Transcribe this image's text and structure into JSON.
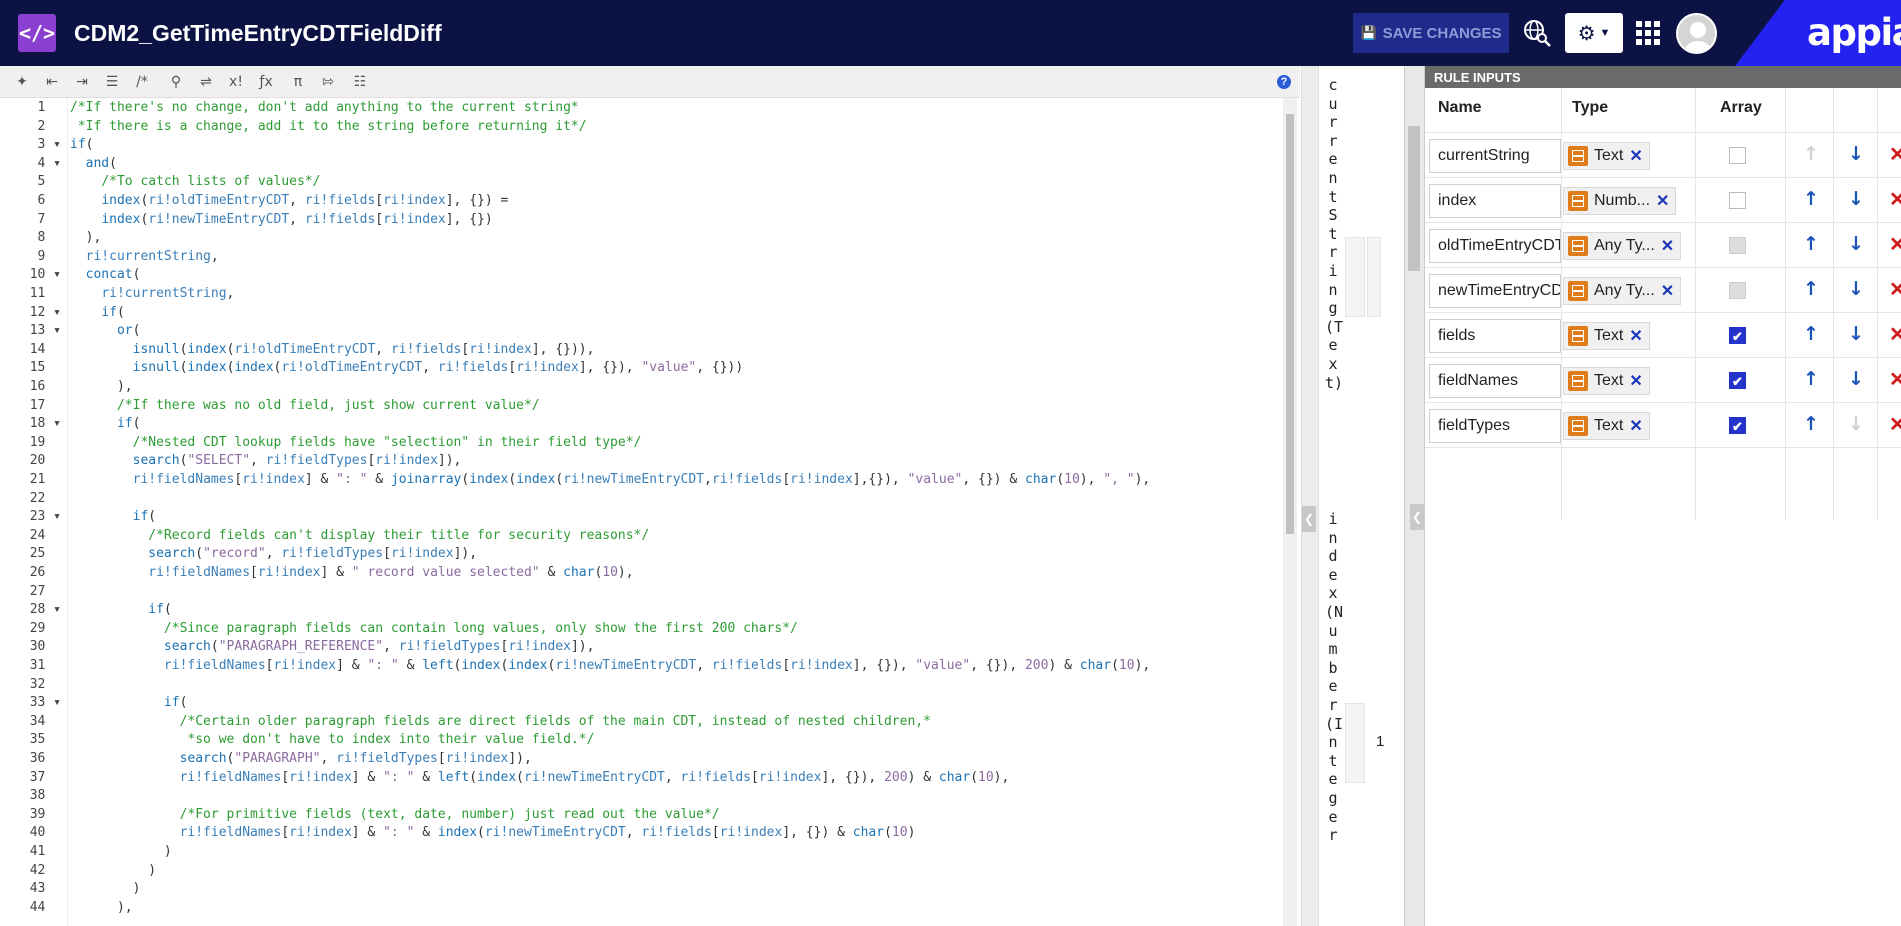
{
  "header": {
    "title": "CDM2_GetTimeEntryCDTFieldDiff",
    "save_label": "SAVE CHANGES",
    "logo": "appian"
  },
  "editor": {
    "lines": [
      [
        [
          "c",
          "/*If there's no change, don't add anything to the current string*"
        ]
      ],
      [
        [
          "c",
          " *If there is a change, add it to the string before returning it*/"
        ]
      ],
      [
        [
          "f",
          "if"
        ],
        [
          "p",
          "("
        ]
      ],
      [
        [
          "p",
          "  "
        ],
        [
          "f",
          "and"
        ],
        [
          "p",
          "("
        ]
      ],
      [
        [
          "p",
          "    "
        ],
        [
          "c",
          "/*To catch lists of values*/"
        ]
      ],
      [
        [
          "p",
          "    "
        ],
        [
          "f",
          "index"
        ],
        [
          "p",
          "("
        ],
        [
          "r",
          "ri!oldTimeEntryCDT"
        ],
        [
          "p",
          ", "
        ],
        [
          "r",
          "ri!fields"
        ],
        [
          "p",
          "["
        ],
        [
          "r",
          "ri!index"
        ],
        [
          "p",
          "], {}) ="
        ]
      ],
      [
        [
          "p",
          "    "
        ],
        [
          "f",
          "index"
        ],
        [
          "p",
          "("
        ],
        [
          "r",
          "ri!newTimeEntryCDT"
        ],
        [
          "p",
          ", "
        ],
        [
          "r",
          "ri!fields"
        ],
        [
          "p",
          "["
        ],
        [
          "r",
          "ri!index"
        ],
        [
          "p",
          "], {})"
        ]
      ],
      [
        [
          "p",
          "  ),"
        ]
      ],
      [
        [
          "p",
          "  "
        ],
        [
          "r",
          "ri!currentString"
        ],
        [
          "p",
          ","
        ]
      ],
      [
        [
          "p",
          "  "
        ],
        [
          "f",
          "concat"
        ],
        [
          "p",
          "("
        ]
      ],
      [
        [
          "p",
          "    "
        ],
        [
          "r",
          "ri!currentString"
        ],
        [
          "p",
          ","
        ]
      ],
      [
        [
          "p",
          "    "
        ],
        [
          "f",
          "if"
        ],
        [
          "p",
          "("
        ]
      ],
      [
        [
          "p",
          "      "
        ],
        [
          "f",
          "or"
        ],
        [
          "p",
          "("
        ]
      ],
      [
        [
          "p",
          "        "
        ],
        [
          "f",
          "isnull"
        ],
        [
          "p",
          "("
        ],
        [
          "f",
          "index"
        ],
        [
          "p",
          "("
        ],
        [
          "r",
          "ri!oldTimeEntryCDT"
        ],
        [
          "p",
          ", "
        ],
        [
          "r",
          "ri!fields"
        ],
        [
          "p",
          "["
        ],
        [
          "r",
          "ri!index"
        ],
        [
          "p",
          "], {})),"
        ]
      ],
      [
        [
          "p",
          "        "
        ],
        [
          "f",
          "isnull"
        ],
        [
          "p",
          "("
        ],
        [
          "f",
          "index"
        ],
        [
          "p",
          "("
        ],
        [
          "f",
          "index"
        ],
        [
          "p",
          "("
        ],
        [
          "r",
          "ri!oldTimeEntryCDT"
        ],
        [
          "p",
          ", "
        ],
        [
          "r",
          "ri!fields"
        ],
        [
          "p",
          "["
        ],
        [
          "r",
          "ri!index"
        ],
        [
          "p",
          "], {}), "
        ],
        [
          "s",
          "\"value\""
        ],
        [
          "p",
          ", {}))"
        ]
      ],
      [
        [
          "p",
          "      ),"
        ]
      ],
      [
        [
          "p",
          "      "
        ],
        [
          "c",
          "/*If there was no old field, just show current value*/"
        ]
      ],
      [
        [
          "p",
          "      "
        ],
        [
          "f",
          "if"
        ],
        [
          "p",
          "("
        ]
      ],
      [
        [
          "p",
          "        "
        ],
        [
          "c",
          "/*Nested CDT lookup fields have \"selection\" in their field type*/"
        ]
      ],
      [
        [
          "p",
          "        "
        ],
        [
          "f",
          "search"
        ],
        [
          "p",
          "("
        ],
        [
          "s",
          "\"SELECT\""
        ],
        [
          "p",
          ", "
        ],
        [
          "r",
          "ri!fieldTypes"
        ],
        [
          "p",
          "["
        ],
        [
          "r",
          "ri!index"
        ],
        [
          "p",
          "]),"
        ]
      ],
      [
        [
          "p",
          "        "
        ],
        [
          "r",
          "ri!fieldNames"
        ],
        [
          "p",
          "["
        ],
        [
          "r",
          "ri!index"
        ],
        [
          "p",
          "] & "
        ],
        [
          "s",
          "\": \""
        ],
        [
          "p",
          " & "
        ],
        [
          "f",
          "joinarray"
        ],
        [
          "p",
          "("
        ],
        [
          "f",
          "index"
        ],
        [
          "p",
          "("
        ],
        [
          "f",
          "index"
        ],
        [
          "p",
          "("
        ],
        [
          "r",
          "ri!newTimeEntryCDT"
        ],
        [
          "p",
          ","
        ],
        [
          "r",
          "ri!fields"
        ],
        [
          "p",
          "["
        ],
        [
          "r",
          "ri!index"
        ],
        [
          "p",
          "],{}), "
        ],
        [
          "s",
          "\"value\""
        ],
        [
          "p",
          ", {}) & "
        ],
        [
          "f",
          "char"
        ],
        [
          "p",
          "("
        ],
        [
          "n",
          "10"
        ],
        [
          "p",
          "), "
        ],
        [
          "s",
          "\", \""
        ],
        [
          "p",
          "),"
        ]
      ],
      [],
      [
        [
          "p",
          "        "
        ],
        [
          "f",
          "if"
        ],
        [
          "p",
          "("
        ]
      ],
      [
        [
          "p",
          "          "
        ],
        [
          "c",
          "/*Record fields can't display their title for security reasons*/"
        ]
      ],
      [
        [
          "p",
          "          "
        ],
        [
          "f",
          "search"
        ],
        [
          "p",
          "("
        ],
        [
          "s",
          "\"record\""
        ],
        [
          "p",
          ", "
        ],
        [
          "r",
          "ri!fieldTypes"
        ],
        [
          "p",
          "["
        ],
        [
          "r",
          "ri!index"
        ],
        [
          "p",
          "]),"
        ]
      ],
      [
        [
          "p",
          "          "
        ],
        [
          "r",
          "ri!fieldNames"
        ],
        [
          "p",
          "["
        ],
        [
          "r",
          "ri!index"
        ],
        [
          "p",
          "] & "
        ],
        [
          "s",
          "\" record value selected\""
        ],
        [
          "p",
          " & "
        ],
        [
          "f",
          "char"
        ],
        [
          "p",
          "("
        ],
        [
          "n",
          "10"
        ],
        [
          "p",
          "),"
        ]
      ],
      [],
      [
        [
          "p",
          "          "
        ],
        [
          "f",
          "if"
        ],
        [
          "p",
          "("
        ]
      ],
      [
        [
          "p",
          "            "
        ],
        [
          "c",
          "/*Since paragraph fields can contain long values, only show the first 200 chars*/"
        ]
      ],
      [
        [
          "p",
          "            "
        ],
        [
          "f",
          "search"
        ],
        [
          "p",
          "("
        ],
        [
          "s",
          "\"PARAGRAPH_REFERENCE\""
        ],
        [
          "p",
          ", "
        ],
        [
          "r",
          "ri!fieldTypes"
        ],
        [
          "p",
          "["
        ],
        [
          "r",
          "ri!index"
        ],
        [
          "p",
          "]),"
        ]
      ],
      [
        [
          "p",
          "            "
        ],
        [
          "r",
          "ri!fieldNames"
        ],
        [
          "p",
          "["
        ],
        [
          "r",
          "ri!index"
        ],
        [
          "p",
          "] & "
        ],
        [
          "s",
          "\": \""
        ],
        [
          "p",
          " & "
        ],
        [
          "f",
          "left"
        ],
        [
          "p",
          "("
        ],
        [
          "f",
          "index"
        ],
        [
          "p",
          "("
        ],
        [
          "f",
          "index"
        ],
        [
          "p",
          "("
        ],
        [
          "r",
          "ri!newTimeEntryCDT"
        ],
        [
          "p",
          ", "
        ],
        [
          "r",
          "ri!fields"
        ],
        [
          "p",
          "["
        ],
        [
          "r",
          "ri!index"
        ],
        [
          "p",
          "], {}), "
        ],
        [
          "s",
          "\"value\""
        ],
        [
          "p",
          ", {}), "
        ],
        [
          "n",
          "200"
        ],
        [
          "p",
          ") & "
        ],
        [
          "f",
          "char"
        ],
        [
          "p",
          "("
        ],
        [
          "n",
          "10"
        ],
        [
          "p",
          "),"
        ]
      ],
      [],
      [
        [
          "p",
          "            "
        ],
        [
          "f",
          "if"
        ],
        [
          "p",
          "("
        ]
      ],
      [
        [
          "p",
          "              "
        ],
        [
          "c",
          "/*Certain older paragraph fields are direct fields of the main CDT, instead of nested children,*"
        ]
      ],
      [
        [
          "p",
          "              "
        ],
        [
          "c",
          " *so we don't have to index into their value field.*/"
        ]
      ],
      [
        [
          "p",
          "              "
        ],
        [
          "f",
          "search"
        ],
        [
          "p",
          "("
        ],
        [
          "s",
          "\"PARAGRAPH\""
        ],
        [
          "p",
          ", "
        ],
        [
          "r",
          "ri!fieldTypes"
        ],
        [
          "p",
          "["
        ],
        [
          "r",
          "ri!index"
        ],
        [
          "p",
          "]),"
        ]
      ],
      [
        [
          "p",
          "              "
        ],
        [
          "r",
          "ri!fieldNames"
        ],
        [
          "p",
          "["
        ],
        [
          "r",
          "ri!index"
        ],
        [
          "p",
          "] & "
        ],
        [
          "s",
          "\": \""
        ],
        [
          "p",
          " & "
        ],
        [
          "f",
          "left"
        ],
        [
          "p",
          "("
        ],
        [
          "f",
          "index"
        ],
        [
          "p",
          "("
        ],
        [
          "r",
          "ri!newTimeEntryCDT"
        ],
        [
          "p",
          ", "
        ],
        [
          "r",
          "ri!fields"
        ],
        [
          "p",
          "["
        ],
        [
          "r",
          "ri!index"
        ],
        [
          "p",
          "], {}), "
        ],
        [
          "n",
          "200"
        ],
        [
          "p",
          ") & "
        ],
        [
          "f",
          "char"
        ],
        [
          "p",
          "("
        ],
        [
          "n",
          "10"
        ],
        [
          "p",
          "),"
        ]
      ],
      [],
      [
        [
          "p",
          "              "
        ],
        [
          "c",
          "/*For primitive fields (text, date, number) just read out the value*/"
        ]
      ],
      [
        [
          "p",
          "              "
        ],
        [
          "r",
          "ri!fieldNames"
        ],
        [
          "p",
          "["
        ],
        [
          "r",
          "ri!index"
        ],
        [
          "p",
          "] & "
        ],
        [
          "s",
          "\": \""
        ],
        [
          "p",
          " & "
        ],
        [
          "f",
          "index"
        ],
        [
          "p",
          "("
        ],
        [
          "r",
          "ri!newTimeEntryCDT"
        ],
        [
          "p",
          ", "
        ],
        [
          "r",
          "ri!fields"
        ],
        [
          "p",
          "["
        ],
        [
          "r",
          "ri!index"
        ],
        [
          "p",
          "], {}) & "
        ],
        [
          "f",
          "char"
        ],
        [
          "p",
          "("
        ],
        [
          "n",
          "10"
        ],
        [
          "p",
          ")"
        ]
      ],
      [
        [
          "p",
          "            )"
        ]
      ],
      [
        [
          "p",
          "          )"
        ]
      ],
      [
        [
          "p",
          "        )"
        ]
      ],
      [
        [
          "p",
          "      ),"
        ]
      ]
    ]
  },
  "test_panel": {
    "entry1_text": "currentString(Text)",
    "entry2_text": "index(Number(Integer",
    "index_value": "1"
  },
  "rule_inputs": {
    "title": "RULE INPUTS",
    "headers": {
      "name": "Name",
      "type": "Type",
      "array": "Array"
    },
    "rows": [
      {
        "name": "currentString",
        "type": "Text",
        "array": "unchecked",
        "up": false,
        "down": true
      },
      {
        "name": "index",
        "type": "Numb...",
        "array": "unchecked",
        "up": true,
        "down": true
      },
      {
        "name": "oldTimeEntryCDT",
        "type": "Any Ty...",
        "array": "disabled",
        "up": true,
        "down": true
      },
      {
        "name": "newTimeEntryCDT",
        "type": "Any Ty...",
        "array": "disabled",
        "up": true,
        "down": true
      },
      {
        "name": "fields",
        "type": "Text",
        "array": "checked",
        "up": true,
        "down": true
      },
      {
        "name": "fieldNames",
        "type": "Text",
        "array": "checked",
        "up": true,
        "down": true
      },
      {
        "name": "fieldTypes",
        "type": "Text",
        "array": "checked",
        "up": true,
        "down": false
      }
    ]
  },
  "icons": {
    "toolbar": [
      "magic-wand-icon",
      "outdent-icon",
      "indent-icon",
      "list-icon",
      "comment-icon",
      "search-icon",
      "shuffle-icon",
      "x-superscript-icon",
      "fx-icon",
      "pi-icon",
      "export-icon",
      "search-list-icon"
    ]
  },
  "colors": {
    "topbar": "#0c1344",
    "accent": "#2322f0",
    "app_icon": "#8a3fd1",
    "comment": "#2d9c34",
    "function": "#1b73b5",
    "string": "#8b6aa0"
  }
}
